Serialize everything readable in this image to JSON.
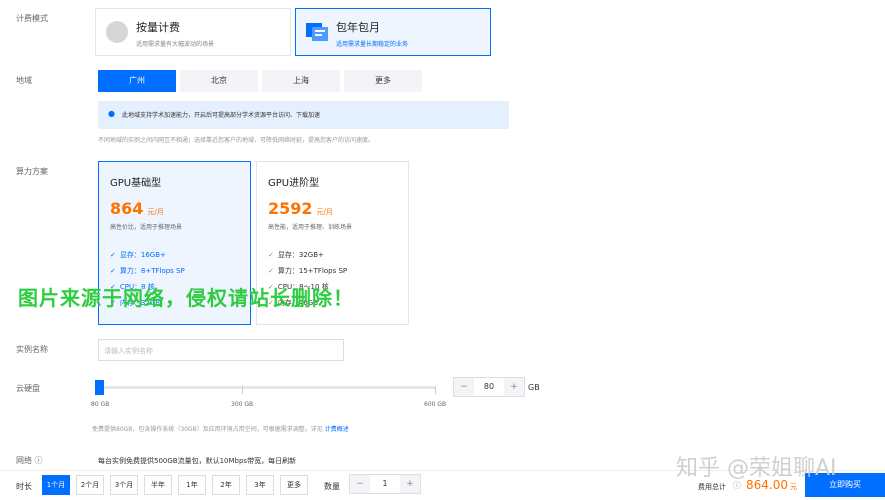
{
  "billing": {
    "label": "计费模式",
    "options": [
      {
        "title": "按量计费",
        "desc": "适用需求量有大幅波动的场景"
      },
      {
        "title": "包年包月",
        "desc": "适用需求量长期稳定的业务"
      }
    ]
  },
  "region": {
    "label": "地域",
    "options": [
      "广州",
      "北京",
      "上海",
      "更多"
    ],
    "notice": "此地域支持学术加速能力，开启后可提高部分学术资源平台访问、下载加速",
    "hint": "不同地域的实例之间内网互不相通；选择靠近您客户的地域，可降低网络时延，提高您客户的访问速度。"
  },
  "plan": {
    "label": "算力方案",
    "cards": [
      {
        "name": "GPU基础型",
        "price": "864",
        "unit": "元/月",
        "desc": "高性价比，适用于推理场景",
        "specs": [
          "显存：16GB+",
          "算力：8+TFlops SP",
          "CPU：8 核",
          "内存：32GB"
        ]
      },
      {
        "name": "GPU进阶型",
        "price": "2592",
        "unit": "元/月",
        "desc": "高性能，适用于推理、训练场景",
        "specs": [
          "显存：32GB+",
          "算力：15+TFlops SP",
          "CPU：8～10 核",
          "内存：40GB"
        ]
      }
    ]
  },
  "instance": {
    "label": "实例名称",
    "placeholder": "请输入实例名称"
  },
  "disk": {
    "label": "云硬盘",
    "ticks": [
      "80 GB",
      "300 GB",
      "600 GB"
    ],
    "value": "80",
    "unit": "GB",
    "minus": "−",
    "plus": "+",
    "note": "免费提供80GB，包含操作系统（30GB）及应用环境占用空间，可根据需求调整。详见",
    "link": "计费概述"
  },
  "network": {
    "label": "网络",
    "text": "每台实例免费提供500GB流量包，默认10Mbps带宽，每日刷新"
  },
  "duration": {
    "label": "时长",
    "options": [
      "1个月",
      "2个月",
      "3个月",
      "半年",
      "1年",
      "2年",
      "3年",
      "更多"
    ]
  },
  "quantity": {
    "label": "数量",
    "value": "1",
    "minus": "−",
    "plus": "+"
  },
  "total": {
    "label": "费用总计",
    "amount": "864.00",
    "unit": "元"
  },
  "buy_label": "立即购买",
  "watermark": "图片来源于网络，侵权请站长删除！",
  "watermark2": "知乎 @荣姐聊AI"
}
